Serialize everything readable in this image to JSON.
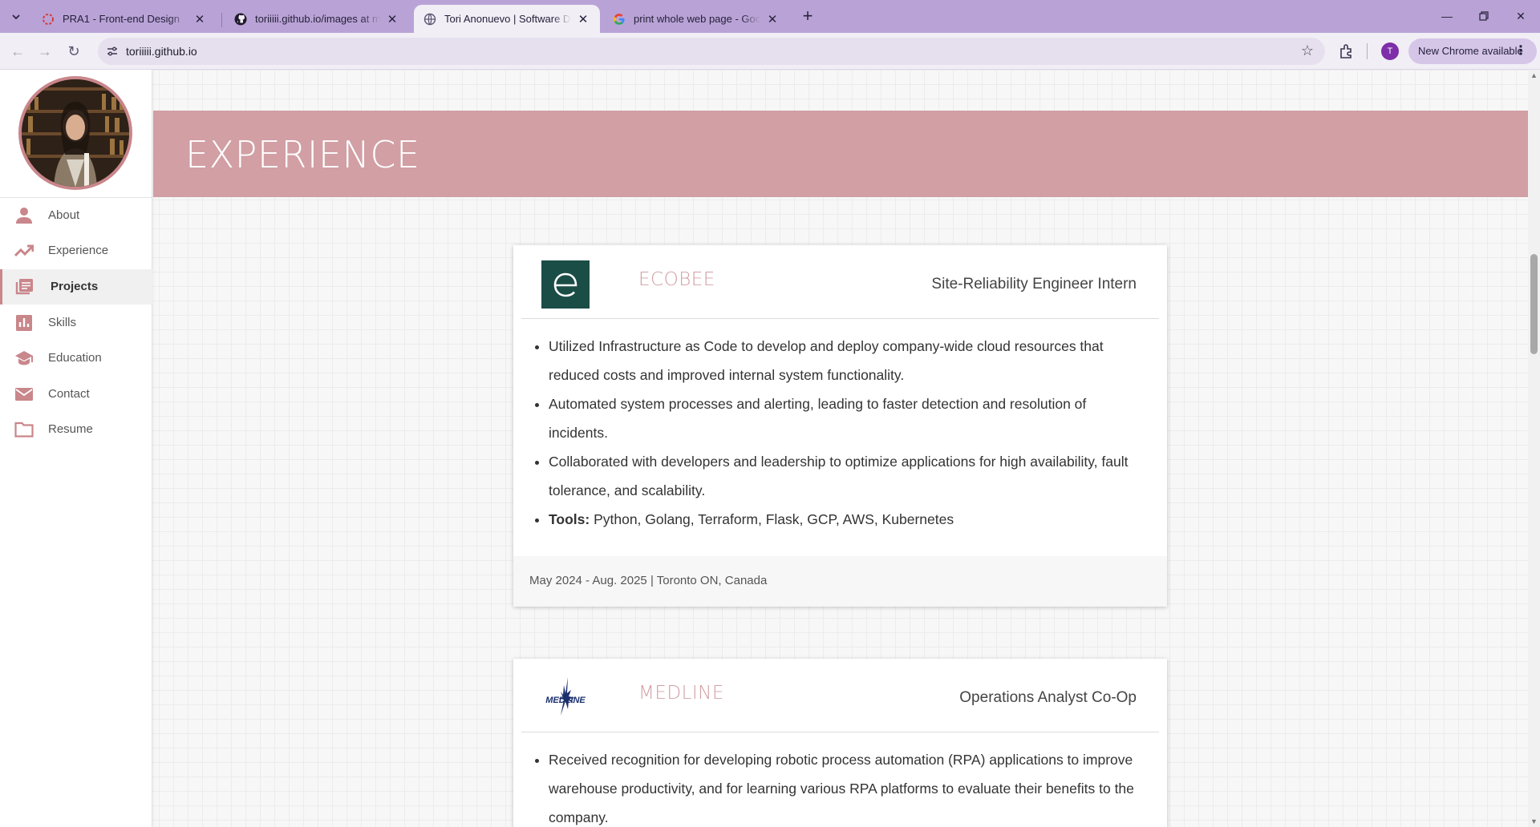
{
  "browser": {
    "tabs": [
      {
        "title": "PRA1 - Front-end Design",
        "icon": "pra-icon",
        "active": false
      },
      {
        "title": "toriiiii.github.io/images at main",
        "icon": "github-icon",
        "active": false
      },
      {
        "title": "Tori Anonuevo | Software Devel",
        "icon": "globe-icon",
        "active": true
      },
      {
        "title": "print whole web page - Google",
        "icon": "google-icon",
        "active": false
      }
    ],
    "url": "toriiiii.github.io",
    "profile_initial": "T",
    "update_label": "New Chrome available",
    "accent_color": "#b9a3d6"
  },
  "sidebar": {
    "items": [
      {
        "label": "About",
        "icon": "person-icon"
      },
      {
        "label": "Experience",
        "icon": "trending-icon"
      },
      {
        "label": "Projects",
        "icon": "library-icon",
        "active": true
      },
      {
        "label": "Skills",
        "icon": "bar-chart-icon"
      },
      {
        "label": "Education",
        "icon": "graduation-cap-icon"
      },
      {
        "label": "Contact",
        "icon": "mail-icon"
      },
      {
        "label": "Resume",
        "icon": "folder-icon"
      }
    ],
    "accent_color": "#c9868b"
  },
  "section": {
    "title": "EXPERIENCE",
    "banner_color": "#d19fa4"
  },
  "experience": [
    {
      "company": "ECOBEE",
      "role": "Site-Reliability Engineer Intern",
      "bullets": [
        "Utilized Infrastructure as Code to develop and deploy company-wide cloud resources that reduced costs and improved internal system functionality.",
        "Automated system processes and alerting, leading to faster detection and resolution of incidents.",
        "Collaborated with developers and leadership to optimize applications for high availability, fault tolerance, and scalability."
      ],
      "tools_label": "Tools:",
      "tools": "Python, Golang, Terraform, Flask, GCP, AWS, Kubernetes",
      "footer": "May 2024 - Aug. 2025 | Toronto ON, Canada"
    },
    {
      "company": "MEDLINE",
      "role": "Operations Analyst Co-Op",
      "bullets": [
        "Received recognition for developing robotic process automation (RPA) applications to improve warehouse productivity, and for learning various RPA platforms to evaluate their benefits to the company."
      ],
      "logo_text": "MEDLINE"
    }
  ]
}
